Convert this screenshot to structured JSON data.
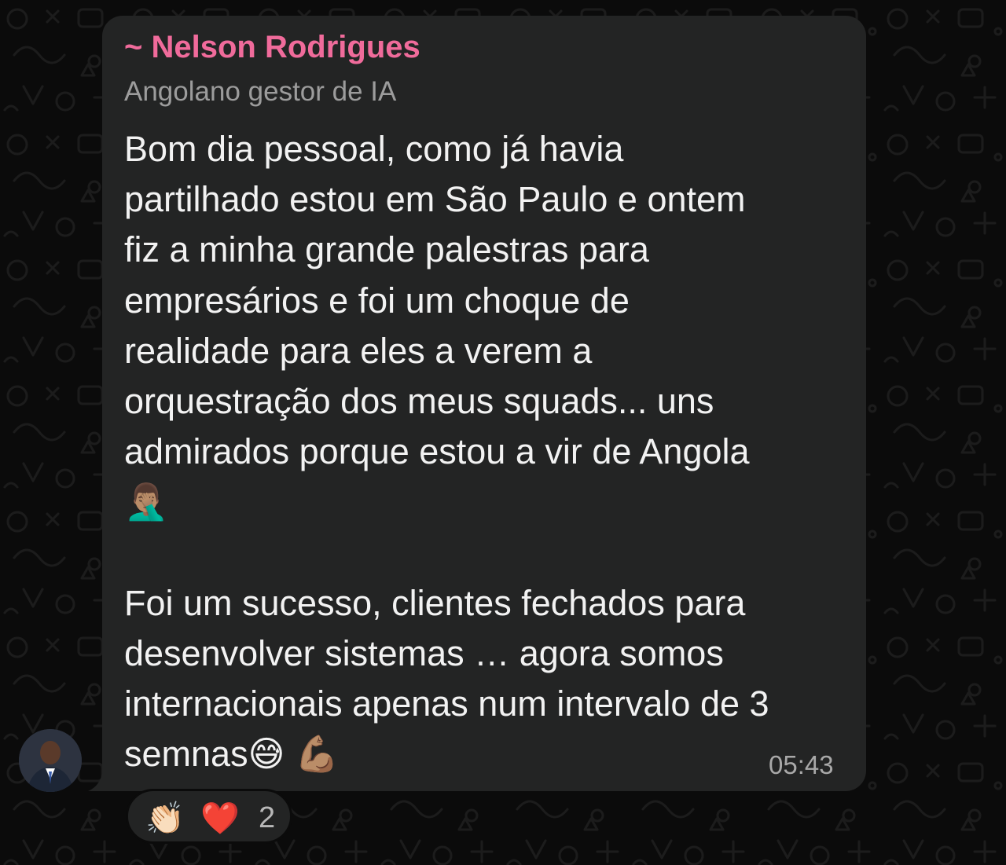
{
  "chat": {
    "sender_name": "~ Nelson Rodrigues",
    "sender_about": "Angolano gestor de IA",
    "message_lines": [
      "Bom dia pessoal, como já havia",
      "partilhado estou em São Paulo e ontem",
      "fiz a minha grande palestras para",
      "empresários e foi um choque de",
      "realidade para eles a verem a",
      "orquestração dos meus squads... uns",
      "admirados porque estou a vir de Angola",
      "",
      "",
      "Foi um sucesso, clientes fechados para",
      "desenvolver sistemas … agora somos",
      "internacionais apenas num intervalo de 3",
      "semnas"
    ],
    "emoji_facepalm": "🤦🏽‍♂️",
    "emoji_sweat_smile": "😅",
    "emoji_flexed_bicep": "💪🏽",
    "timestamp": "05:43",
    "reactions": {
      "items": [
        "👏🏻",
        "❤️"
      ],
      "count": "2"
    }
  },
  "colors": {
    "background": "#0b0b0b",
    "bubble": "#232424",
    "sender_name": "#f06b9b",
    "about_text": "#9c9c9c",
    "message_text": "#f2f2f2",
    "timestamp": "#a8a8a8"
  }
}
